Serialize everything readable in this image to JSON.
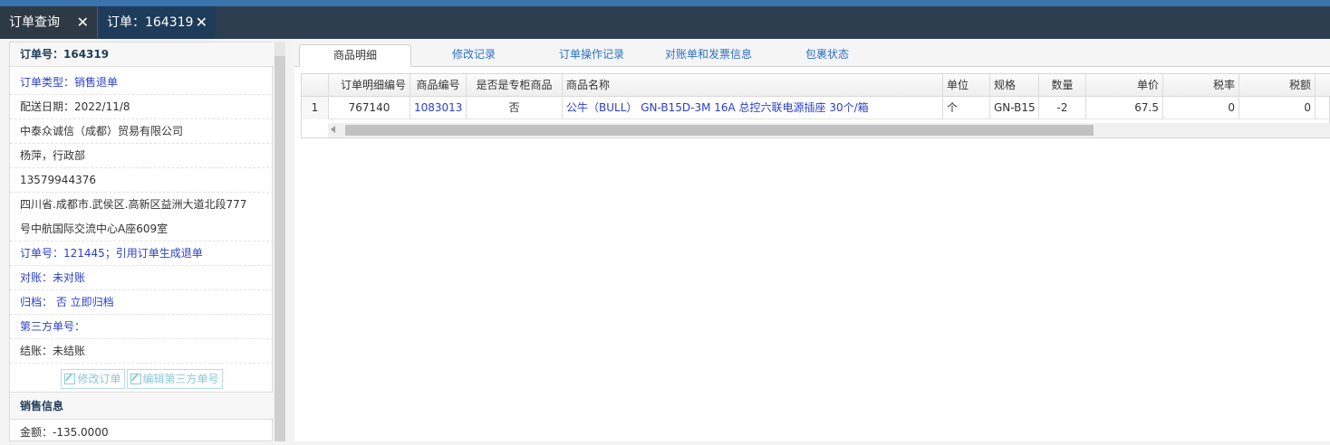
{
  "tabs": [
    {
      "label": "订单查询",
      "close": "✕"
    },
    {
      "label": "订单：164319",
      "close": "✕"
    }
  ],
  "left_panel": {
    "order_no": "订单号：164319",
    "order_type": "订单类型：销售退单",
    "delivery_date": "配送日期：2022/11/8",
    "company": "中泰众诚信（成都）贸易有限公司",
    "contact": "杨萍，行政部",
    "phone": "13579944376",
    "address_line1": "四川省.成都市.武侯区.高新区益洲大道北段777",
    "address_line2": "号中航国际交流中心A座609室",
    "ref_order": "订单号：121445；引用订单生成退单",
    "reconcile": "对账：未对账",
    "archive": "归档：  否 立即归档",
    "third_party": "第三方单号：",
    "settle": "结账：未结账",
    "btn_edit_order": "修改订单",
    "btn_edit_third": "编辑第三方单号",
    "sales_header": "销售信息",
    "amount": "金额：-135.0000"
  },
  "subtabs": [
    "商品明细",
    "修改记录",
    "订单操作记录",
    "对账单和发票信息",
    "包裹状态"
  ],
  "table": {
    "columns": [
      "",
      "订单明细编号",
      "商品编号",
      "是否是专柜商品",
      "商品名称",
      "单位",
      "规格",
      "数量",
      "单价",
      "税率",
      "税额"
    ],
    "rows": [
      [
        "1",
        "767140",
        "1083013",
        "否",
        "公牛（BULL） GN-B15D-3M 16A 总控六联电源插座 30个/箱",
        "个",
        "GN-B15",
        "-2",
        "67.5",
        "0",
        "0"
      ]
    ]
  },
  "colors": {
    "tabbar": "#2c3e50",
    "accent": "#3b73ad",
    "link": "#2b3fc9"
  }
}
